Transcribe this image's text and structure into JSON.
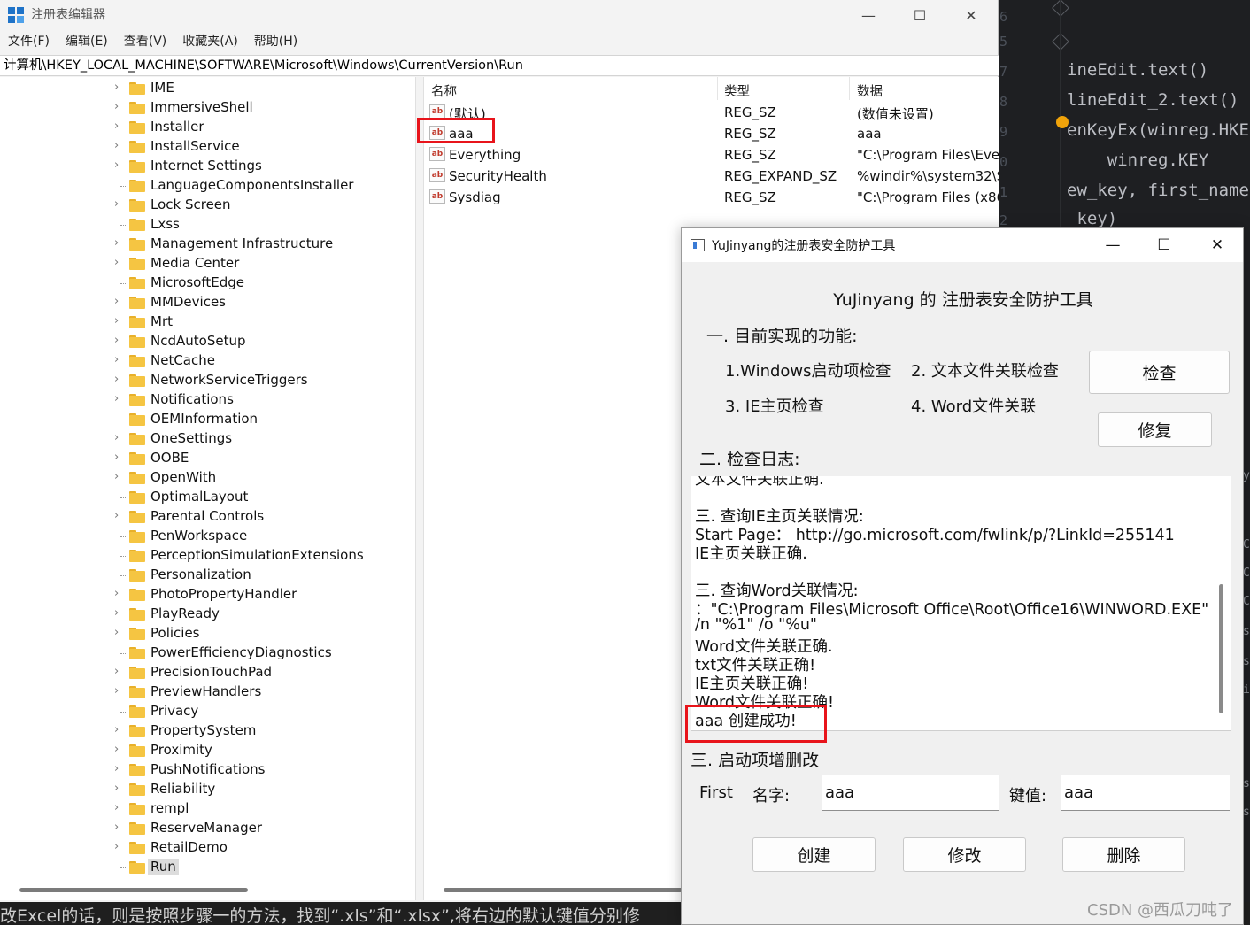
{
  "regedit": {
    "title": "注册表编辑器",
    "menu": [
      "文件(F)",
      "编辑(E)",
      "查看(V)",
      "收藏夹(A)",
      "帮助(H)"
    ],
    "address": "计算机\\HKEY_LOCAL_MACHINE\\SOFTWARE\\Microsoft\\Windows\\CurrentVersion\\Run",
    "tree": [
      {
        "label": "IME",
        "expandable": true
      },
      {
        "label": "ImmersiveShell",
        "expandable": true
      },
      {
        "label": "Installer",
        "expandable": true
      },
      {
        "label": "InstallService",
        "expandable": true
      },
      {
        "label": "Internet Settings",
        "expandable": true
      },
      {
        "label": "LanguageComponentsInstaller",
        "expandable": false
      },
      {
        "label": "Lock Screen",
        "expandable": true
      },
      {
        "label": "Lxss",
        "expandable": false
      },
      {
        "label": "Management Infrastructure",
        "expandable": true
      },
      {
        "label": "Media Center",
        "expandable": true
      },
      {
        "label": "MicrosoftEdge",
        "expandable": false
      },
      {
        "label": "MMDevices",
        "expandable": true
      },
      {
        "label": "Mrt",
        "expandable": true
      },
      {
        "label": "NcdAutoSetup",
        "expandable": true
      },
      {
        "label": "NetCache",
        "expandable": true
      },
      {
        "label": "NetworkServiceTriggers",
        "expandable": true
      },
      {
        "label": "Notifications",
        "expandable": true
      },
      {
        "label": "OEMInformation",
        "expandable": false
      },
      {
        "label": "OneSettings",
        "expandable": true
      },
      {
        "label": "OOBE",
        "expandable": true
      },
      {
        "label": "OpenWith",
        "expandable": true
      },
      {
        "label": "OptimalLayout",
        "expandable": false
      },
      {
        "label": "Parental Controls",
        "expandable": true
      },
      {
        "label": "PenWorkspace",
        "expandable": false
      },
      {
        "label": "PerceptionSimulationExtensions",
        "expandable": false
      },
      {
        "label": "Personalization",
        "expandable": false
      },
      {
        "label": "PhotoPropertyHandler",
        "expandable": true
      },
      {
        "label": "PlayReady",
        "expandable": true
      },
      {
        "label": "Policies",
        "expandable": true
      },
      {
        "label": "PowerEfficiencyDiagnostics",
        "expandable": false
      },
      {
        "label": "PrecisionTouchPad",
        "expandable": true
      },
      {
        "label": "PreviewHandlers",
        "expandable": true
      },
      {
        "label": "Privacy",
        "expandable": false
      },
      {
        "label": "PropertySystem",
        "expandable": true
      },
      {
        "label": "Proximity",
        "expandable": true
      },
      {
        "label": "PushNotifications",
        "expandable": true
      },
      {
        "label": "Reliability",
        "expandable": true
      },
      {
        "label": "rempl",
        "expandable": true
      },
      {
        "label": "ReserveManager",
        "expandable": true
      },
      {
        "label": "RetailDemo",
        "expandable": true
      },
      {
        "label": "Run",
        "expandable": false,
        "selected": true
      }
    ],
    "columns": {
      "name": "名称",
      "type": "类型",
      "data": "数据"
    },
    "values": [
      {
        "name": "(默认)",
        "type": "REG_SZ",
        "data": "(数值未设置)"
      },
      {
        "name": "aaa",
        "type": "REG_SZ",
        "data": "aaa"
      },
      {
        "name": "Everything",
        "type": "REG_SZ",
        "data": "\"C:\\Program Files\\Ever"
      },
      {
        "name": "SecurityHealth",
        "type": "REG_EXPAND_SZ",
        "data": "%windir%\\system32\\S"
      },
      {
        "name": "Sysdiag",
        "type": "REG_SZ",
        "data": "\"C:\\Program Files (x86"
      }
    ],
    "value_icon": "ab"
  },
  "tool": {
    "window_title": "YuJinyang的注册表安全防护工具",
    "heading": "YuJinyang 的 注册表安全防护工具",
    "section1": "一. 目前实现的功能:",
    "features": [
      "1.Windows启动项检查",
      "2. 文本文件关联检查",
      "3. IE主页检查",
      "4. Word文件关联"
    ],
    "check_button": "检查",
    "repair_button": "修复",
    "section2": "二. 检查日志:",
    "log": [
      "文本文件关联正确.",
      "",
      "三. 查询IE主页关联情况:",
      "Start Page： http://go.microsoft.com/fwlink/p/?LinkId=255141",
      "IE主页关联正确.",
      "",
      "三. 查询Word关联情况:",
      "：\"C:\\Program Files\\Microsoft Office\\Root\\Office16\\WINWORD.EXE\"",
      "/n \"%1\" /o \"%u\"",
      "Word文件关联正确.",
      "txt文件关联正确!",
      "IE主页关联正确!",
      "Word文件关联正确!",
      "aaa  创建成功!"
    ],
    "section3": "三. 启动项增删改",
    "first_label": "First",
    "name_label": "名字:",
    "name_value": "aaa",
    "key_label": "键值:",
    "key_value": "aaa",
    "create_button": "创建",
    "modify_button": "修改",
    "delete_button": "删除"
  },
  "code_editor": {
    "lines": [
      {
        "text": "ineEdit.text()"
      },
      {
        "text": "lineEdit_2.text()"
      },
      {
        "text": "enKeyEx(winreg.HKE"
      },
      {
        "text": "    winreg.KEY"
      },
      {
        "text": "ew_key, first_name"
      },
      {
        "text": " key)"
      }
    ],
    "line_numbers": [
      "6",
      "5",
      "7",
      "8",
      "9",
      "0",
      "1",
      "2"
    ],
    "right_marks": [
      "y",
      "C",
      "C",
      "C",
      "s",
      "s",
      "i",
      "s",
      "s"
    ]
  },
  "blog": {
    "text": "改Excel的话，则是按照步骤一的方法，找到“.xls”和“.xlsx”,将右边的默认键值分别修",
    "watermark": "CSDN @西瓜刀吨了"
  },
  "colors": {
    "highlight_box": "#e8141b",
    "folder": "#f5c542"
  }
}
